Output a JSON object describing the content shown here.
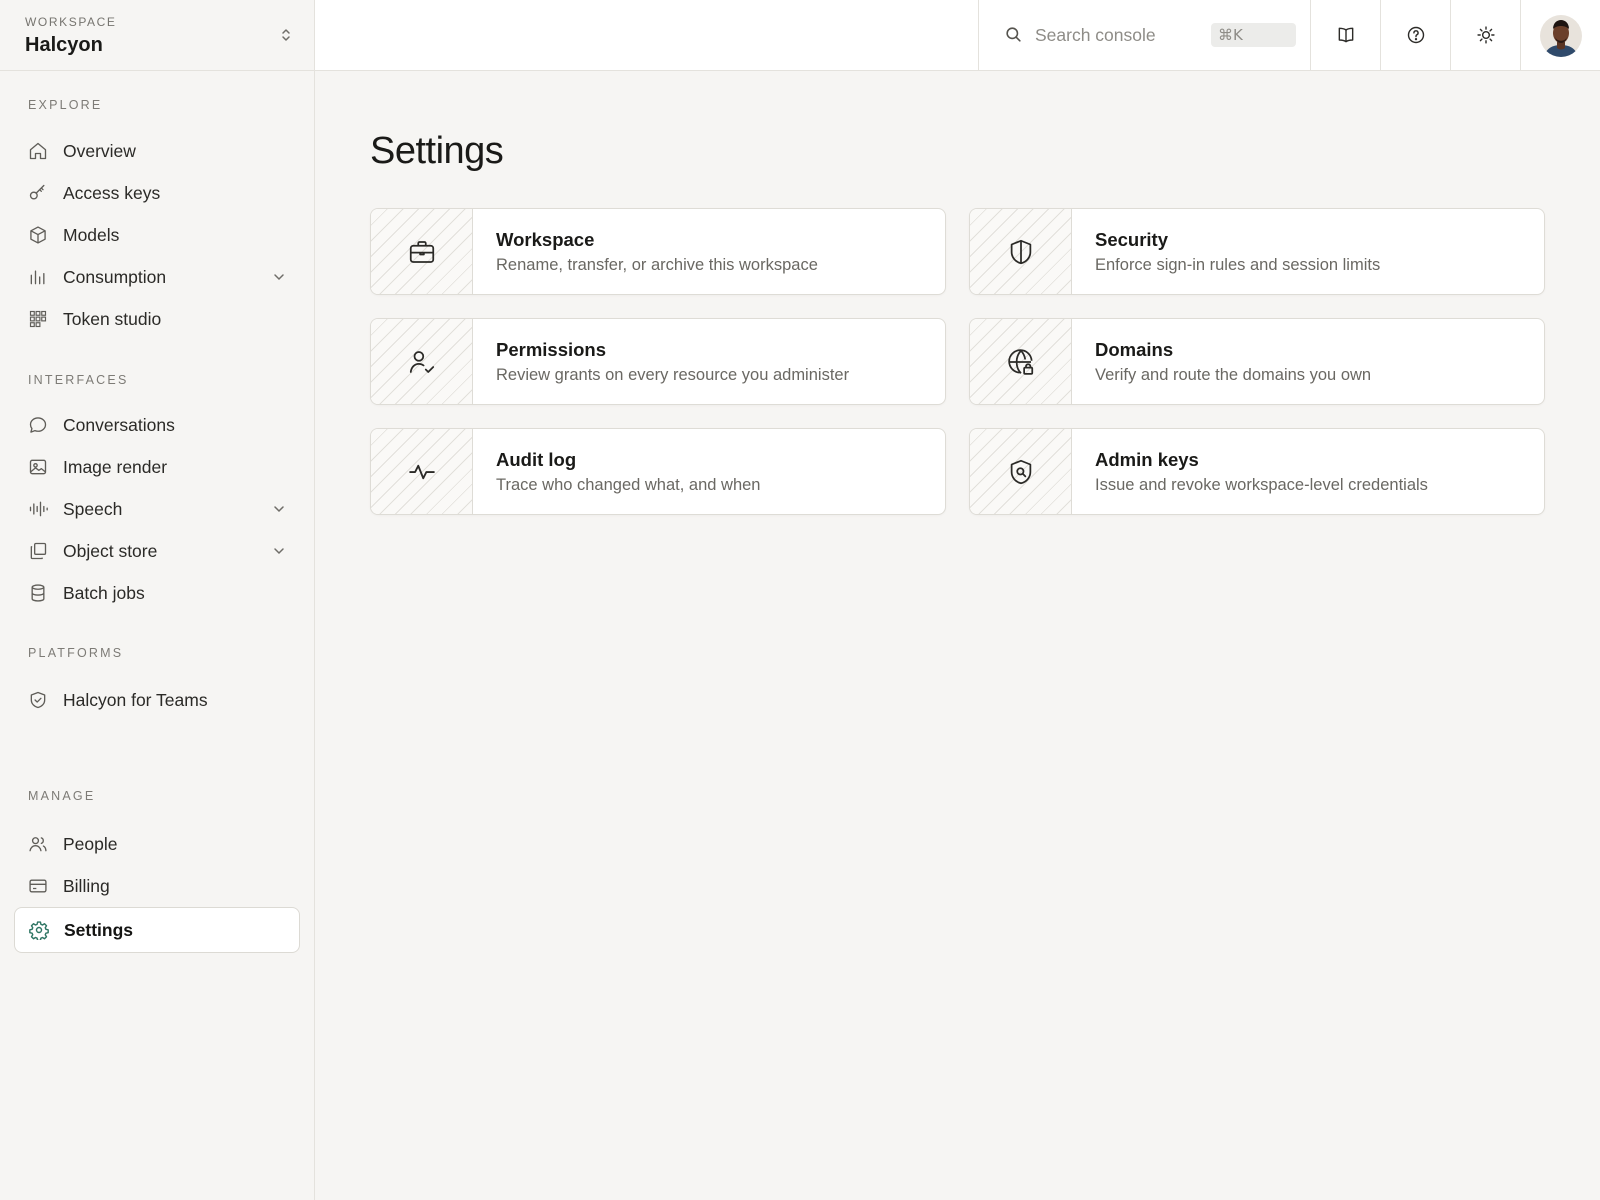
{
  "workspace": {
    "label": "WORKSPACE",
    "name": "Halcyon"
  },
  "sidebar": {
    "sections": [
      {
        "label": "EXPLORE",
        "items": [
          {
            "label": "Overview",
            "icon": "home-icon"
          },
          {
            "label": "Access keys",
            "icon": "key-icon"
          },
          {
            "label": "Models",
            "icon": "cube-icon"
          },
          {
            "label": "Consumption",
            "icon": "bar-chart-icon",
            "expandable": true
          },
          {
            "label": "Token studio",
            "icon": "grid-icon"
          }
        ]
      },
      {
        "label": "INTERFACES",
        "items": [
          {
            "label": "Conversations",
            "icon": "chat-bubble-icon"
          },
          {
            "label": "Image render",
            "icon": "image-icon"
          },
          {
            "label": "Speech",
            "icon": "waveform-icon",
            "expandable": true
          },
          {
            "label": "Object store",
            "icon": "copy-icon",
            "expandable": true
          },
          {
            "label": "Batch jobs",
            "icon": "database-icon"
          }
        ]
      },
      {
        "label": "PLATFORMS",
        "items": [
          {
            "label": "Halcyon for Teams",
            "icon": "shield-check-icon"
          }
        ]
      },
      {
        "label": "MANAGE",
        "items": [
          {
            "label": "People",
            "icon": "users-icon"
          },
          {
            "label": "Billing",
            "icon": "credit-card-icon"
          },
          {
            "label": "Settings",
            "icon": "gear-icon",
            "active": true
          }
        ]
      }
    ]
  },
  "topbar": {
    "search": {
      "placeholder": "Search console",
      "shortcut": "⌘K"
    },
    "buttons": [
      "book-icon",
      "help-icon",
      "sun-icon"
    ],
    "avatar": "user-avatar"
  },
  "main": {
    "title": "Settings",
    "cards": [
      {
        "title": "Workspace",
        "description": "Rename, transfer, or archive this workspace",
        "icon": "briefcase-icon"
      },
      {
        "title": "Security",
        "description": "Enforce sign-in rules and session limits",
        "icon": "shield-icon"
      },
      {
        "title": "Permissions",
        "description": "Review grants on every resource you administer",
        "icon": "user-check-icon"
      },
      {
        "title": "Domains",
        "description": "Verify and route the domains you own",
        "icon": "globe-lock-icon"
      },
      {
        "title": "Audit log",
        "description": "Trace who changed what, and when",
        "icon": "activity-icon"
      },
      {
        "title": "Admin keys",
        "description": "Issue and revoke workspace-level credentials",
        "icon": "shield-search-icon"
      }
    ]
  },
  "colors": {
    "background": "#f6f5f3",
    "accent": "#2e7563",
    "border": "#e4e2dd"
  }
}
